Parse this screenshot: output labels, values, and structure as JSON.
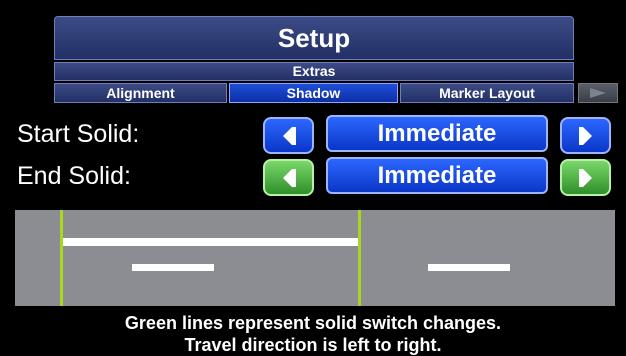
{
  "header": {
    "title": "Setup",
    "subtitle": "Extras"
  },
  "tabs": [
    {
      "label": "Alignment",
      "active": false
    },
    {
      "label": "Shadow",
      "active": true
    },
    {
      "label": "Marker Layout",
      "active": false
    }
  ],
  "settings": {
    "start_solid": {
      "label": "Start Solid:",
      "value": "Immediate"
    },
    "end_solid": {
      "label": "End Solid:",
      "value": "Immediate"
    }
  },
  "icons": {
    "prev": "left-arrow-icon",
    "next": "right-arrow-icon",
    "tab_scroll": "tab-scroll-right-icon"
  },
  "colors": {
    "button_blue": "#1a4fe6",
    "button_green": "#4caf3f",
    "switch_line": "#a8d81e",
    "panel_gray": "#8b8d92"
  },
  "caption": {
    "line1": "Green lines represent solid switch changes.",
    "line2": "Travel direction is left to right."
  }
}
